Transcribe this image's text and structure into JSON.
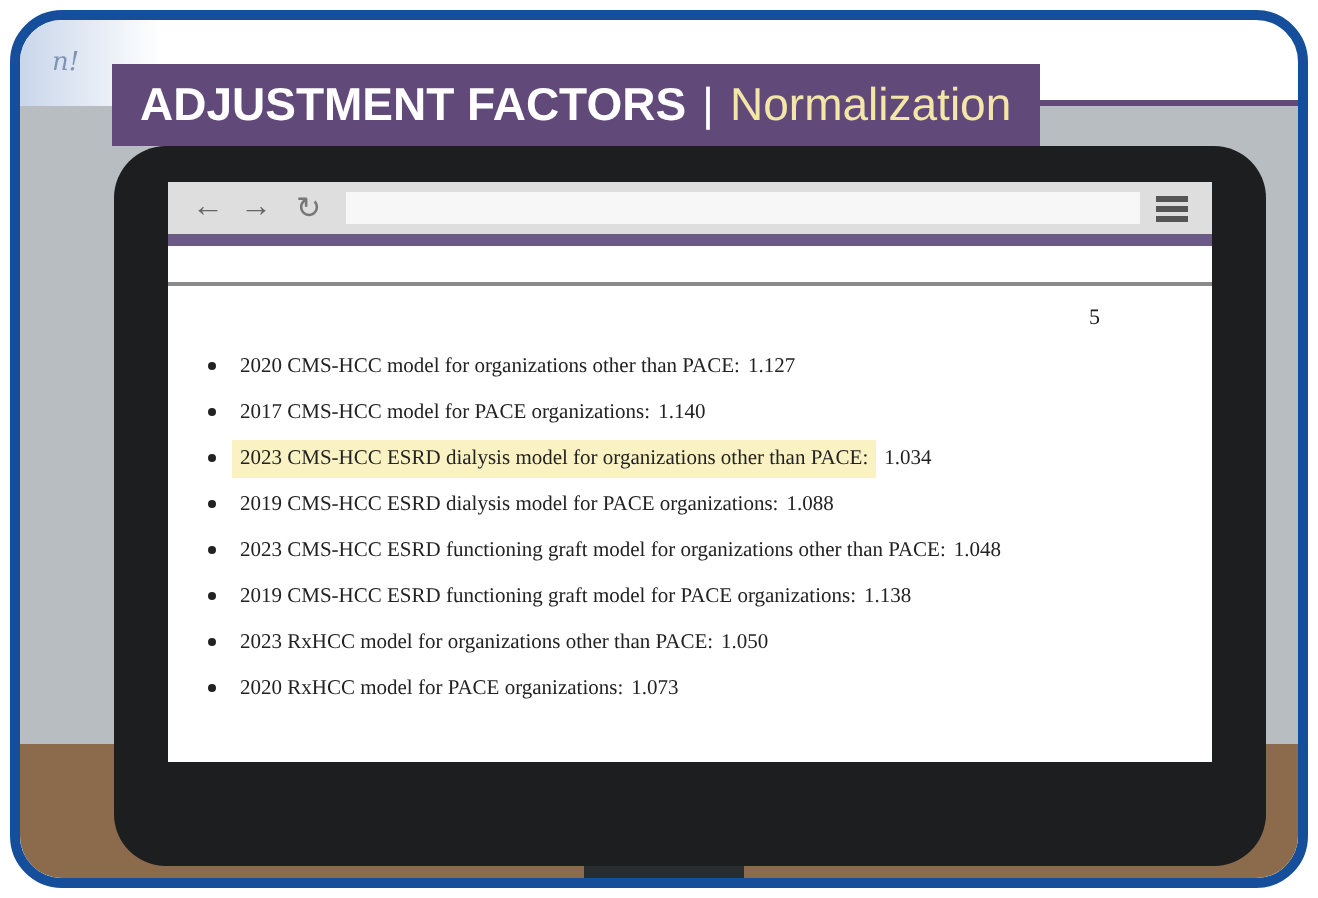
{
  "logo": "n!",
  "title": {
    "main": "ADJUSTMENT FACTORS",
    "separator": "|",
    "sub": "Normalization"
  },
  "browser": {
    "back": "←",
    "forward": "→",
    "reload": "↻"
  },
  "document": {
    "page_number": "5",
    "items": [
      {
        "text": "2020 CMS-HCC model for organizations other than PACE:",
        "value": "1.127",
        "highlighted": false
      },
      {
        "text": "2017 CMS-HCC model for PACE organizations:",
        "value": "1.140",
        "highlighted": false
      },
      {
        "text": "2023 CMS-HCC ESRD dialysis model for organizations other than PACE:",
        "value": "1.034",
        "highlighted": true
      },
      {
        "text": "2019 CMS-HCC ESRD dialysis model for PACE organizations:",
        "value": "1.088",
        "highlighted": false
      },
      {
        "text": "2023 CMS-HCC ESRD functioning graft model for organizations other than PACE:",
        "value": "1.048",
        "highlighted": false
      },
      {
        "text": "2019 CMS-HCC ESRD functioning graft model for PACE organizations:",
        "value": "1.138",
        "highlighted": false
      },
      {
        "text": "2023 RxHCC model for organizations other than PACE:",
        "value": "1.050",
        "highlighted": false
      },
      {
        "text": "2020 RxHCC model for PACE organizations:",
        "value": "1.073",
        "highlighted": false
      }
    ]
  }
}
